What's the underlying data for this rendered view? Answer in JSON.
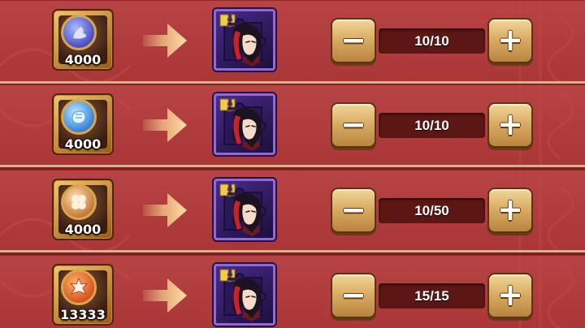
{
  "colors": {
    "row_background": "#b3393b",
    "row_divider": "#d9b08c",
    "button_gold": "#d7a960",
    "quantity_box": "#5c1715",
    "puzzle_frame": "#8e6ad8"
  },
  "exchanges": [
    {
      "cost_icon": "purple-dragon-coin-icon",
      "cost_amount": "4000",
      "result_icon": "hero-puzzle-piece-icon",
      "quantity": "10/10",
      "minus": "−",
      "plus": "+"
    },
    {
      "cost_icon": "blue-fist-coin-icon",
      "cost_amount": "4000",
      "result_icon": "hero-puzzle-piece-icon",
      "quantity": "10/10",
      "minus": "−",
      "plus": "+"
    },
    {
      "cost_icon": "clover-coin-icon",
      "cost_amount": "4000",
      "result_icon": "hero-puzzle-piece-icon",
      "quantity": "10/50",
      "minus": "−",
      "plus": "+"
    },
    {
      "cost_icon": "star-burst-coin-icon",
      "cost_amount": "13333",
      "result_icon": "hero-puzzle-piece-icon",
      "quantity": "15/15",
      "minus": "−",
      "plus": "+"
    }
  ]
}
